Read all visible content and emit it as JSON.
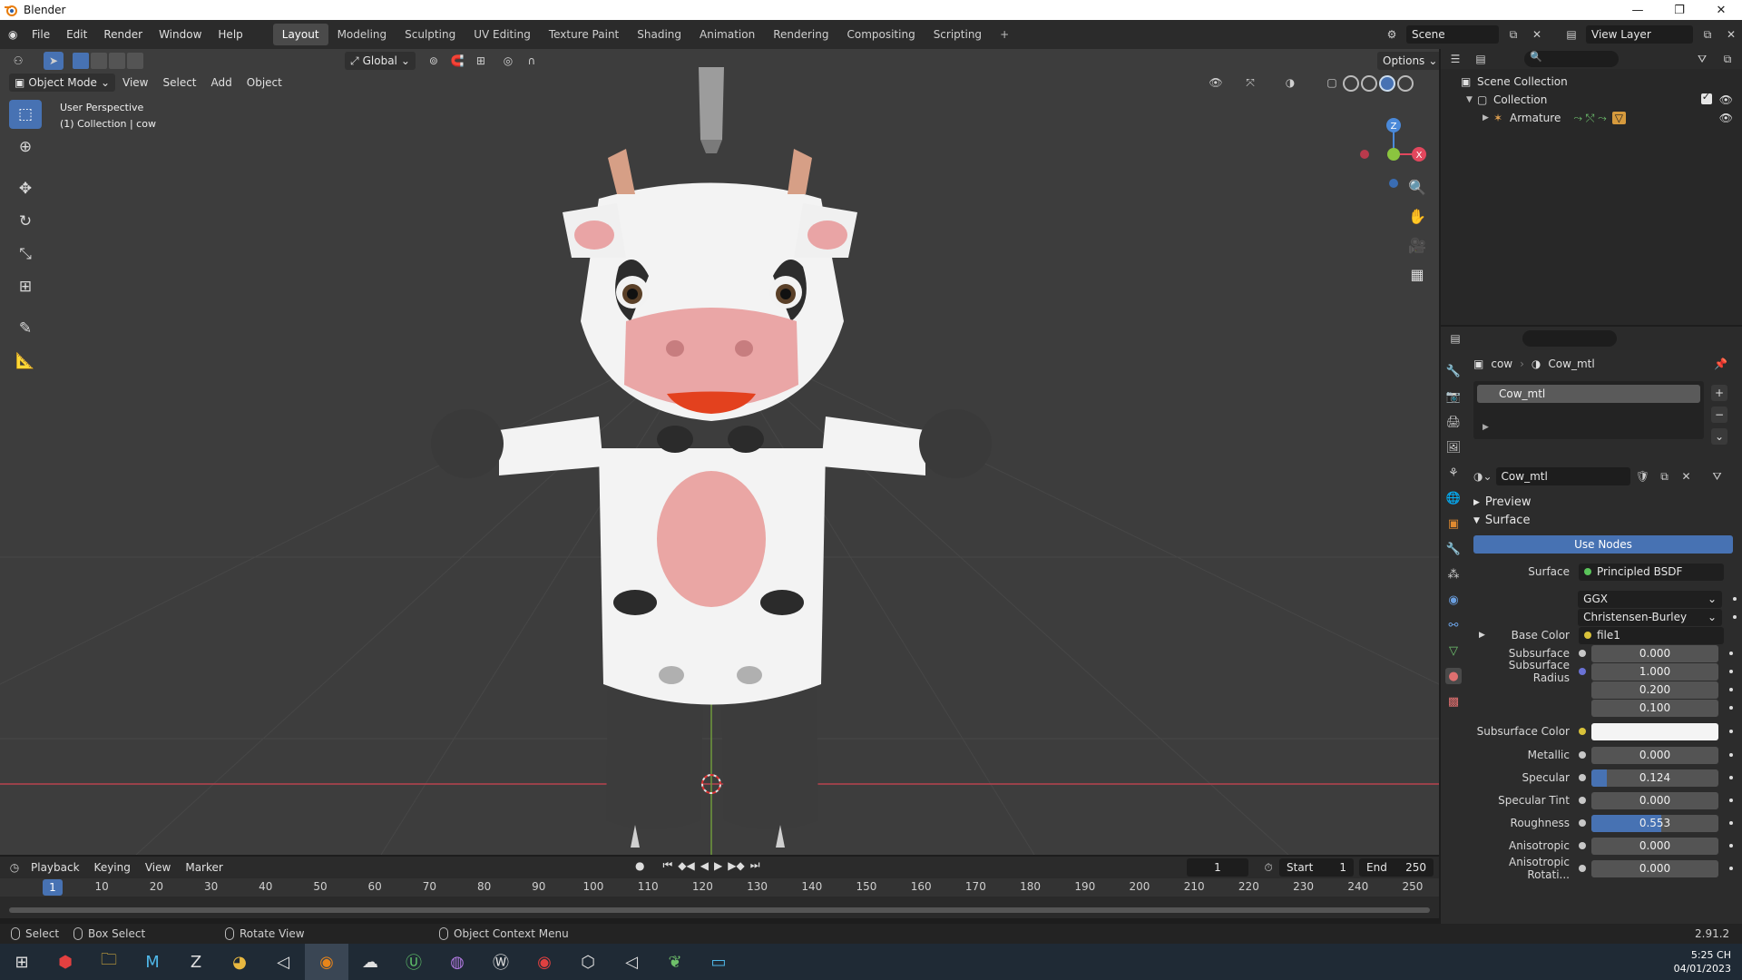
{
  "window": {
    "title": "Blender"
  },
  "menu": [
    "File",
    "Edit",
    "Render",
    "Window",
    "Help"
  ],
  "workspaces": {
    "tabs": [
      "Layout",
      "Modeling",
      "Sculpting",
      "UV Editing",
      "Texture Paint",
      "Shading",
      "Animation",
      "Rendering",
      "Compositing",
      "Scripting"
    ],
    "active": "Layout"
  },
  "scene": {
    "name": "Scene",
    "view_layer": "View Layer"
  },
  "viewport": {
    "transform_orientation": "Global",
    "options_label": "Options",
    "mode": "Object Mode",
    "header_menus": [
      "View",
      "Select",
      "Add",
      "Object"
    ],
    "info_line1": "User Perspective",
    "info_line2": "(1) Collection | cow",
    "gizmo_axes": {
      "x": "X",
      "y": "Y",
      "z": "Z"
    }
  },
  "timeline": {
    "menus": [
      "Playback",
      "Keying",
      "View",
      "Marker"
    ],
    "current_frame": "1",
    "start_label": "Start",
    "start": "1",
    "end_label": "End",
    "end": "250",
    "ruler_ticks": [
      "1",
      "10",
      "20",
      "30",
      "40",
      "50",
      "60",
      "70",
      "80",
      "90",
      "100",
      "110",
      "120",
      "130",
      "140",
      "150",
      "160",
      "170",
      "180",
      "190",
      "200",
      "210",
      "220",
      "230",
      "240",
      "250"
    ]
  },
  "statusbar": {
    "select": "Select",
    "box_select": "Box Select",
    "rotate_view": "Rotate View",
    "context_menu": "Object Context Menu",
    "version": "2.91.2"
  },
  "outliner": {
    "scene_collection": "Scene Collection",
    "collection": "Collection",
    "armature": "Armature"
  },
  "properties": {
    "breadcrumb_object": "cow",
    "breadcrumb_material": "Cow_mtl",
    "slot": "Cow_mtl",
    "material_name": "Cow_mtl",
    "preview_label": "Preview",
    "surface_panel": "Surface",
    "use_nodes": "Use Nodes",
    "rows": {
      "surface": {
        "label": "Surface",
        "value": "Principled BSDF"
      },
      "distribution": "GGX",
      "subsurface_method": "Christensen-Burley",
      "base_color": {
        "label": "Base Color",
        "value": "file1"
      },
      "subsurface": {
        "label": "Subsurface",
        "value": "0.000"
      },
      "subsurface_radius": {
        "label": "Subsurface Radius",
        "values": [
          "1.000",
          "0.200",
          "0.100"
        ]
      },
      "subsurface_color": {
        "label": "Subsurface Color"
      },
      "metallic": {
        "label": "Metallic",
        "value": "0.000"
      },
      "specular": {
        "label": "Specular",
        "value": "0.124",
        "fill": 0.124
      },
      "specular_tint": {
        "label": "Specular Tint",
        "value": "0.000"
      },
      "roughness": {
        "label": "Roughness",
        "value": "0.553",
        "fill": 0.553
      },
      "anisotropic": {
        "label": "Anisotropic",
        "value": "0.000"
      },
      "anisotropic_rotation": {
        "label": "Anisotropic Rotati...",
        "value": "0.000"
      }
    }
  },
  "taskbar": {
    "apps": [
      "windows-start",
      "app-red",
      "file-explorer",
      "app-m",
      "app-zbrush",
      "chrome",
      "unity",
      "blender",
      "app-cloud",
      "app-u",
      "github",
      "app-w",
      "app-notify",
      "app-cube",
      "unity-2",
      "app-leaf",
      "app-screen"
    ],
    "time": "5:25 CH",
    "date": "04/01/2023"
  },
  "colors": {
    "accent": "#4772b3",
    "viewport_bg": "#3d3d3d",
    "x_axis": "#e2475d",
    "y_axis": "#8bc53f",
    "z_axis": "#4a89d9"
  }
}
